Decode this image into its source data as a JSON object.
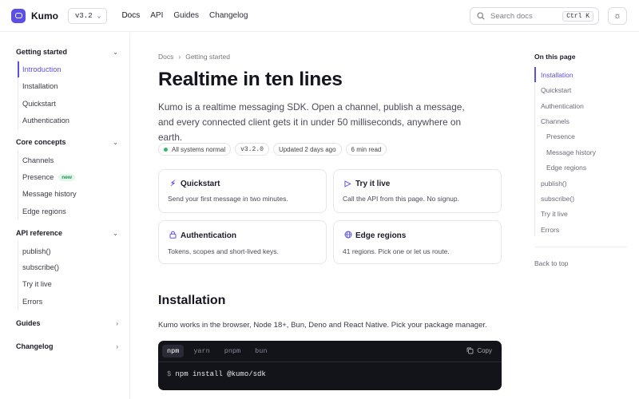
{
  "header": {
    "brand": "Kumo",
    "version": "v3.2",
    "nav": [
      "Docs",
      "API",
      "Guides",
      "Changelog"
    ],
    "search_placeholder": "Search docs",
    "search_shortcut": "Ctrl K"
  },
  "sidebar": {
    "sections": [
      {
        "title": "Getting started",
        "expanded": true,
        "items": [
          "Introduction",
          "Installation",
          "Quickstart",
          "Authentication"
        ]
      },
      {
        "title": "Core concepts",
        "expanded": true,
        "items": [
          "Channels",
          "Presence",
          "Message history",
          "Edge regions"
        ]
      },
      {
        "title": "API reference",
        "expanded": true,
        "items": [
          "publish()",
          "subscribe()",
          "Try it live",
          "Errors"
        ]
      },
      {
        "title": "Guides",
        "expanded": false,
        "items": []
      },
      {
        "title": "Changelog",
        "expanded": false,
        "items": []
      }
    ],
    "active_item": "Introduction",
    "new_badge": "new"
  },
  "main": {
    "breadcrumb": [
      "Docs",
      "Getting started"
    ],
    "title": "Realtime in ten lines",
    "lede": "Kumo is a realtime messaging SDK. Open a channel, publish a message, and every connected client gets it in under 50 milliseconds, anywhere on earth.",
    "chips": {
      "status": "All systems normal",
      "version": "v3.2.0",
      "updated": "Updated 2 days ago",
      "read_time": "6 min read"
    },
    "cards": [
      {
        "title": "Quickstart",
        "desc": "Send your first message in two minutes.",
        "icon": "lightning-icon"
      },
      {
        "title": "Try it live",
        "desc": "Call the API from this page. No signup.",
        "icon": "play-icon"
      },
      {
        "title": "Authentication",
        "desc": "Tokens, scopes and short-lived keys.",
        "icon": "lock-icon"
      },
      {
        "title": "Edge regions",
        "desc": "41 regions. Pick one or let us route.",
        "icon": "globe-icon"
      }
    ],
    "installation": {
      "heading": "Installation",
      "text": "Kumo works in the browser, Node 18+, Bun, Deno and React Native. Pick your package manager.",
      "tabs": [
        "npm",
        "yarn",
        "pnpm",
        "bun"
      ],
      "active_tab": "npm",
      "copy_label": "Copy",
      "prompt": "$",
      "command": "npm install @kumo/sdk"
    }
  },
  "toc": {
    "title": "On this page",
    "items": [
      "Installation",
      "Quickstart",
      "Authentication",
      "Channels",
      "Presence",
      "Message history",
      "Edge regions",
      "publish()",
      "subscribe()",
      "Try it live",
      "Errors"
    ],
    "active": "Installation",
    "back_to_top": "Back to top"
  },
  "colors": {
    "accent": "#5b4fe6",
    "status_ok": "#2fb866",
    "code_bg": "#13131a"
  }
}
